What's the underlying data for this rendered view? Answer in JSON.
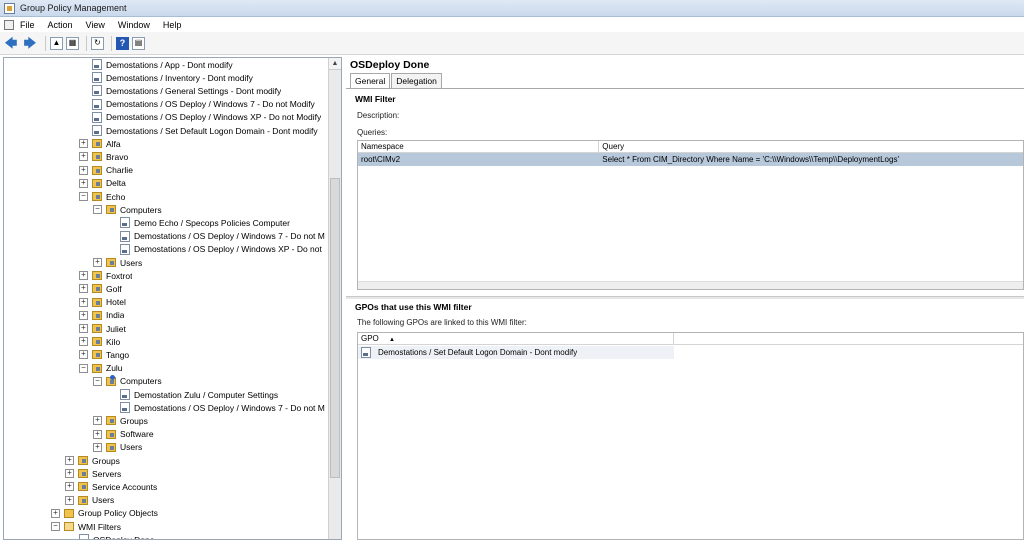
{
  "window": {
    "title": "Group Policy Management"
  },
  "menu": [
    "File",
    "Action",
    "View",
    "Window",
    "Help"
  ],
  "toolbar": {
    "back": "🡄",
    "forward": "🡆",
    "help": "?"
  },
  "tree": [
    {
      "label": "Demostations  / App - Dont modify",
      "indent": 88,
      "icon": "doc",
      "exp": ""
    },
    {
      "label": "Demostations  / Inventory - Dont modify",
      "indent": 88,
      "icon": "doc",
      "exp": ""
    },
    {
      "label": "Demostations / General Settings - Dont modify",
      "indent": 88,
      "icon": "doc",
      "exp": ""
    },
    {
      "label": "Demostations / OS Deploy / Windows 7 - Do not Modify",
      "indent": 88,
      "icon": "doc",
      "exp": ""
    },
    {
      "label": "Demostations / OS Deploy / Windows XP - Do not Modify",
      "indent": 88,
      "icon": "doc",
      "exp": ""
    },
    {
      "label": "Demostations / Set Default Logon Domain - Dont modify",
      "indent": 88,
      "icon": "doc",
      "exp": ""
    },
    {
      "label": "Alfa",
      "indent": 75,
      "icon": "ou",
      "exp": "+"
    },
    {
      "label": "Bravo",
      "indent": 75,
      "icon": "ou",
      "exp": "+"
    },
    {
      "label": "Charlie",
      "indent": 75,
      "icon": "ou",
      "exp": "+"
    },
    {
      "label": "Delta",
      "indent": 75,
      "icon": "ou",
      "exp": "+"
    },
    {
      "label": "Echo",
      "indent": 75,
      "icon": "ou",
      "exp": "−"
    },
    {
      "label": "Computers",
      "indent": 89,
      "icon": "ou",
      "exp": "−"
    },
    {
      "label": "Demo Echo / Specops Policies Computer",
      "indent": 116,
      "icon": "doc",
      "exp": ""
    },
    {
      "label": "Demostations / OS Deploy / Windows 7 - Do not M",
      "indent": 116,
      "icon": "doc",
      "exp": ""
    },
    {
      "label": "Demostations / OS Deploy / Windows XP - Do not",
      "indent": 116,
      "icon": "doc",
      "exp": ""
    },
    {
      "label": "Users",
      "indent": 89,
      "icon": "ou",
      "exp": "+"
    },
    {
      "label": "Foxtrot",
      "indent": 75,
      "icon": "ou",
      "exp": "+"
    },
    {
      "label": "Golf",
      "indent": 75,
      "icon": "ou",
      "exp": "+"
    },
    {
      "label": "Hotel",
      "indent": 75,
      "icon": "ou",
      "exp": "+"
    },
    {
      "label": "India",
      "indent": 75,
      "icon": "ou",
      "exp": "+"
    },
    {
      "label": "Juliet",
      "indent": 75,
      "icon": "ou",
      "exp": "+"
    },
    {
      "label": "Kilo",
      "indent": 75,
      "icon": "ou",
      "exp": "+"
    },
    {
      "label": "Tango",
      "indent": 75,
      "icon": "ou",
      "exp": "+"
    },
    {
      "label": "Zulu",
      "indent": 75,
      "icon": "ou",
      "exp": "−"
    },
    {
      "label": "Computers",
      "indent": 89,
      "icon": "ou info",
      "exp": "−"
    },
    {
      "label": "Demostation Zulu / Computer Settings",
      "indent": 116,
      "icon": "doc",
      "exp": ""
    },
    {
      "label": "Demostations / OS Deploy / Windows 7 - Do not M",
      "indent": 116,
      "icon": "doc",
      "exp": ""
    },
    {
      "label": "Groups",
      "indent": 89,
      "icon": "ou",
      "exp": "+"
    },
    {
      "label": "Software",
      "indent": 89,
      "icon": "ou",
      "exp": "+"
    },
    {
      "label": "Users",
      "indent": 89,
      "icon": "ou",
      "exp": "+"
    },
    {
      "label": "Groups",
      "indent": 61,
      "icon": "ou",
      "exp": "+"
    },
    {
      "label": "Servers",
      "indent": 61,
      "icon": "ou",
      "exp": "+"
    },
    {
      "label": "Service Accounts",
      "indent": 61,
      "icon": "ou",
      "exp": "+"
    },
    {
      "label": "Users",
      "indent": 61,
      "icon": "ou",
      "exp": "+"
    },
    {
      "label": "Group Policy Objects",
      "indent": 47,
      "icon": "gpo",
      "exp": "+"
    },
    {
      "label": "WMI Filters",
      "indent": 47,
      "icon": "wmi",
      "exp": "−"
    },
    {
      "label": "OSDeploy Done",
      "indent": 75,
      "icon": "doc",
      "exp": ""
    }
  ],
  "detail": {
    "heading": "OSDeploy Done",
    "tabs": [
      "General",
      "Delegation"
    ],
    "wmi_filter_title": "WMI Filter",
    "description_label": "Description:",
    "queries_label": "Queries:",
    "queries_columns": [
      "Namespace",
      "Query"
    ],
    "queries_rows": [
      {
        "namespace": "root\\CIMv2",
        "query": "Select * From CIM_Directory Where Name = 'C:\\\\Windows\\\\Temp\\\\DeploymentLogs'"
      }
    ],
    "gpos_title": "GPOs that use this WMI filter",
    "gpos_subtitle": "The following GPOs are linked to this WMI filter:",
    "gpos_column": "GPO",
    "gpos_sort": "▲",
    "gpos_rows": [
      "Demostations / Set Default Logon Domain - Dont modify"
    ]
  },
  "colors": {
    "selection": "#b7c8db",
    "titlebar": "#c9d9ec"
  }
}
